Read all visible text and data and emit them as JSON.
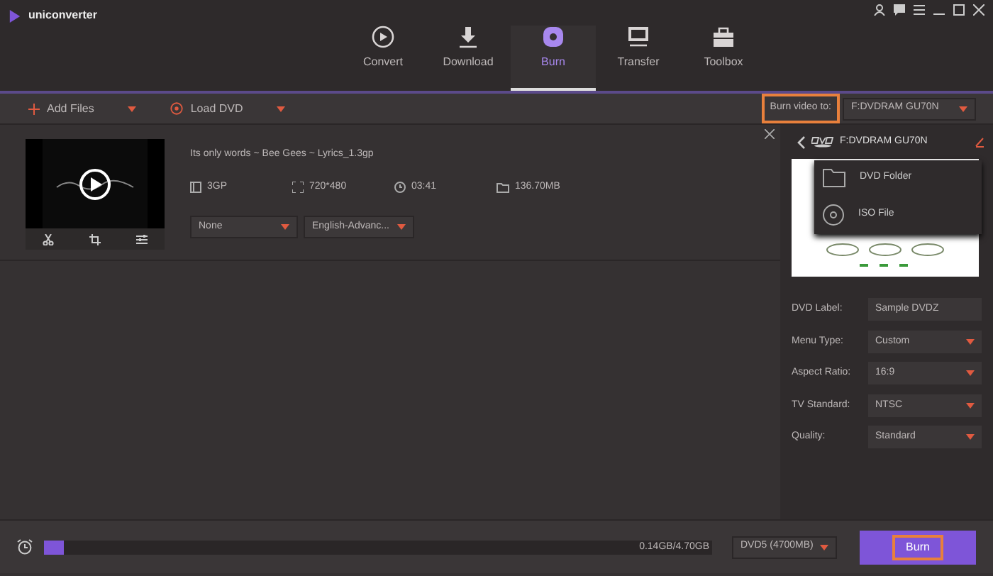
{
  "window": {
    "title": "uniconverter"
  },
  "nav_tabs": [
    {
      "label": "Convert",
      "kind": "convert",
      "selected": false
    },
    {
      "label": "Download",
      "kind": "download",
      "selected": false
    },
    {
      "label": "Burn",
      "kind": "burn",
      "selected": true
    },
    {
      "label": "Transfer",
      "kind": "transfer",
      "selected": false
    },
    {
      "label": "Toolbox",
      "kind": "toolbox",
      "selected": false
    }
  ],
  "toolbar": {
    "add_files": "Add Files",
    "load_dvd": "Load DVD",
    "burn_to_label": "Burn video to:",
    "burn_to_highlighted": true,
    "burn_to_value": "F:DVDRAM GU70N"
  },
  "file": {
    "name": "Its only words ~ Bee Gees ~ Lyrics_1.3gp",
    "format": "3GP",
    "resolution": "720*480",
    "duration": "03:41",
    "size": "136.70MB",
    "subtitle": "None",
    "audio": "English-Advanc..."
  },
  "panel": {
    "drive": "F:DVDRAM GU70N",
    "menu": [
      {
        "label": "DVD Folder",
        "kind": "folder"
      },
      {
        "label": "ISO File",
        "kind": "iso"
      }
    ],
    "settings": [
      {
        "label": "DVD Label:",
        "value": "Sample DVDZ",
        "kind": "text"
      },
      {
        "label": "Menu Type:",
        "value": "Custom",
        "kind": "select"
      },
      {
        "label": "Aspect Ratio:",
        "value": "16:9",
        "kind": "select"
      },
      {
        "label": "TV Standard:",
        "value": "NTSC",
        "kind": "select"
      },
      {
        "label": "Quality:",
        "value": "Standard",
        "kind": "select"
      }
    ]
  },
  "bottom": {
    "level": 0.03,
    "reading": "0.14GB/4.70GB",
    "disc_type": "DVD5 (4700MB)",
    "burn": "Burn",
    "burn_highlighted": true
  }
}
